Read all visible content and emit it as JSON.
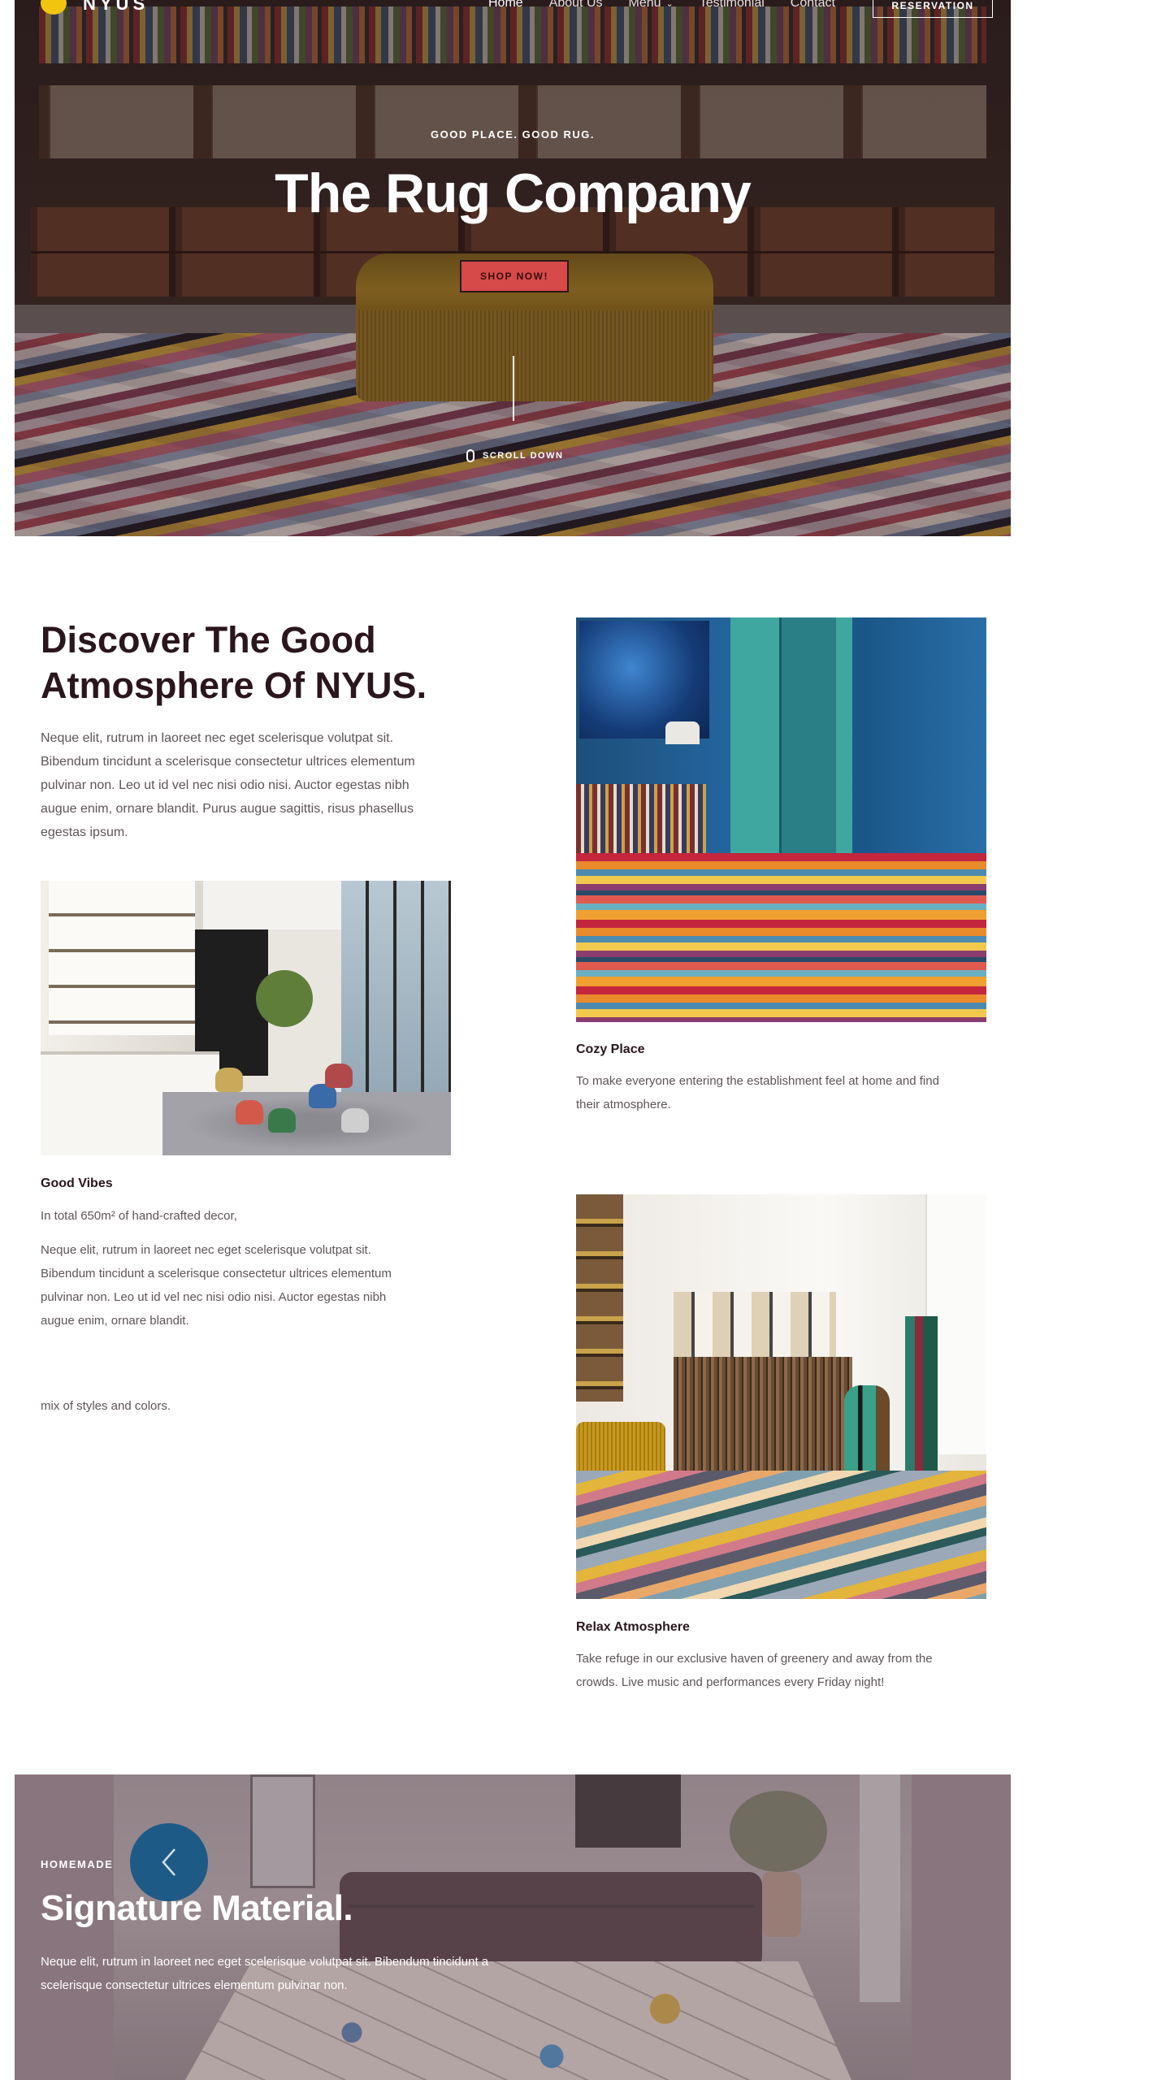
{
  "nav": {
    "brand": "NYUS",
    "links": [
      {
        "label": "Home",
        "active": true
      },
      {
        "label": "About Us",
        "active": false
      },
      {
        "label": "Menu",
        "active": false,
        "dropdown": true
      },
      {
        "label": "Testimonial",
        "active": false
      },
      {
        "label": "Contact",
        "active": false
      }
    ],
    "cta": "RESERVATION"
  },
  "hero": {
    "eyebrow": "GOOD PLACE. GOOD RUG.",
    "title": "The Rug Company",
    "button": "SHOP NOW!",
    "scroll": "SCROLL DOWN"
  },
  "discover": {
    "title": "Discover The Good Atmosphere Of NYUS.",
    "text": "Neque elit, rutrum in laoreet nec eget scelerisque volutpat sit. Bibendum tincidunt a scelerisque consectetur ultrices elementum pulvinar non. Leo ut id vel nec nisi odio nisi. Auctor egestas nibh augue enim, ornare blandit. Purus augue sagittis, risus phasellus egestas ipsum."
  },
  "features": {
    "good_vibes": {
      "title": "Good Vibes",
      "line1": "In total 650m² of hand-crafted decor,",
      "line2": "Neque elit, rutrum in laoreet nec eget scelerisque volutpat sit. Bibendum tincidunt a scelerisque consectetur ultrices elementum pulvinar non. Leo ut id vel nec nisi odio nisi. Auctor egestas nibh augue enim, ornare blandit.",
      "line3": "mix of styles and colors."
    },
    "cozy_place": {
      "title": "Cozy Place",
      "text": "To make everyone entering the establishment feel at home and find their atmosphere."
    },
    "relax": {
      "title": "Relax Atmosphere",
      "text": "Take refuge in our exclusive haven of greenery and away from the crowds. Live music and performances every Friday night!"
    }
  },
  "signature": {
    "eyebrow": "HOMEMADE",
    "title": "Signature Material.",
    "text": "Neque elit, rutrum in laoreet nec eget scelerisque volutpat sit. Bibendum tincidunt a scelerisque consectetur ultrices elementum pulvinar non."
  },
  "colors": {
    "brand_dot": "#f1c40f",
    "shop_button": "#d64a4a",
    "slider_button": "#1e5a86",
    "heading": "#2a161c"
  },
  "icons": [
    "logo-dot-icon",
    "chevron-down-icon",
    "mouse-icon",
    "chevron-left-icon"
  ]
}
